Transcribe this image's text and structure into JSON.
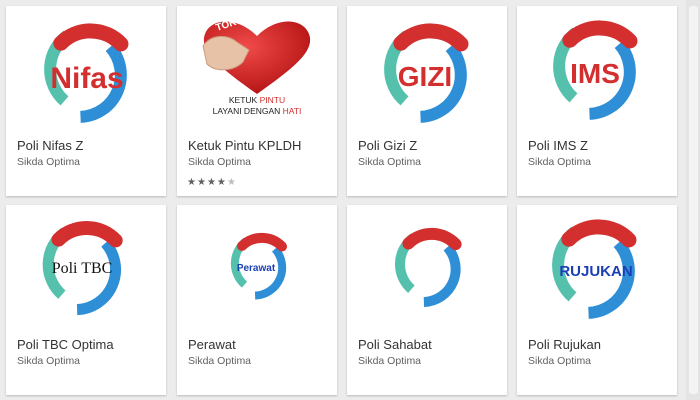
{
  "apps": [
    {
      "title": "Poli Nifas Z",
      "developer": "Sikda Optima",
      "icon_text": "Nifas",
      "icon": "poli-nifas-logo-icon"
    },
    {
      "title": "Ketuk Pintu KPLDH",
      "developer": "Sikda Optima",
      "icon": "heart-knock-icon",
      "heart_text": "TOK TOK",
      "caption_line1_a": "KETUK ",
      "caption_line1_b": "PINTU",
      "caption_line2_a": "LAYANI DENGAN ",
      "caption_line2_b": "HATI",
      "rating": 4,
      "rating_max": 5
    },
    {
      "title": "Poli Gizi Z",
      "developer": "Sikda Optima",
      "icon_text": "GIZI",
      "icon": "poli-gizi-logo-icon"
    },
    {
      "title": "Poli IMS Z",
      "developer": "Sikda Optima",
      "icon_text": "IMS",
      "icon": "poli-ims-logo-icon"
    },
    {
      "title": "Poli TBC Optima",
      "developer": "Sikda Optima",
      "icon_text": "Poli TBC",
      "icon": "poli-tbc-logo-icon"
    },
    {
      "title": "Perawat",
      "developer": "Sikda Optima",
      "icon_text": "Perawat",
      "icon": "perawat-logo-icon"
    },
    {
      "title": "Poli Sahabat",
      "developer": "Sikda Optima",
      "icon": "poli-sahabat-logo-icon"
    },
    {
      "title": "Poli Rujukan",
      "developer": "Sikda Optima",
      "icon_text": "RUJUKAN",
      "icon": "poli-rujukan-logo-icon"
    }
  ],
  "colors": {
    "logo_red": "#d32f2f",
    "logo_blue": "#2e8fd6",
    "logo_teal": "#55c1ad",
    "star_on": "#616161",
    "star_off": "#bdbdbd"
  }
}
